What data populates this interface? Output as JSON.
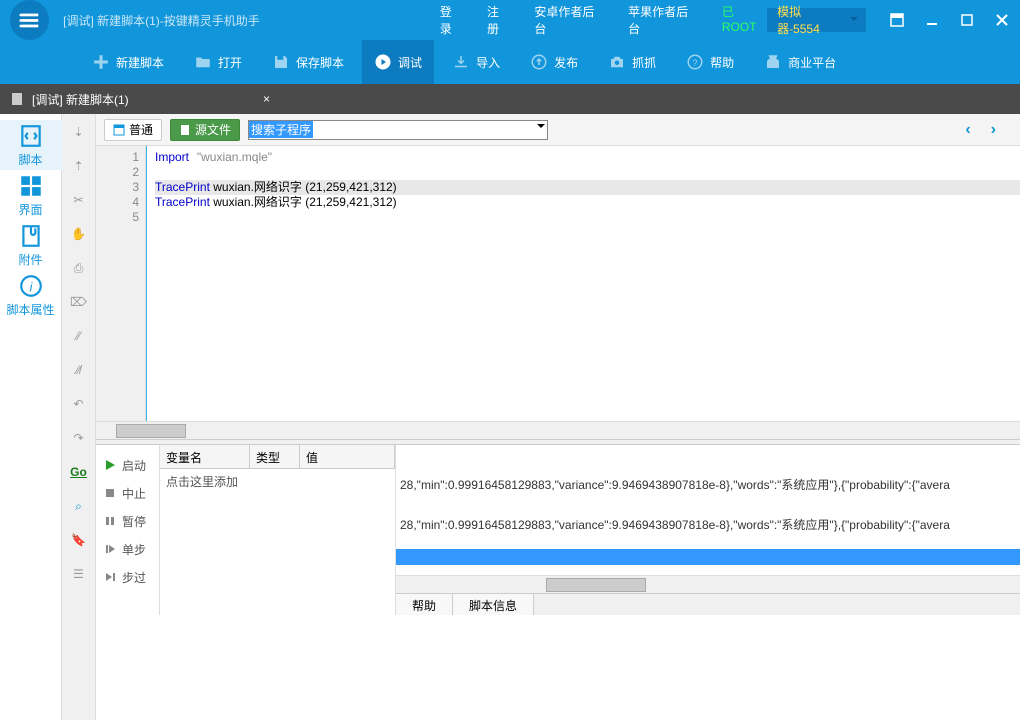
{
  "titlebar": {
    "title": "[调试] 新建脚本(1)-按键精灵手机助手",
    "links": {
      "login": "登录",
      "register": "注册",
      "android": "安卓作者后台",
      "ios": "苹果作者后台",
      "root": "已ROOT"
    },
    "device": "模拟器-5554"
  },
  "toolbar": {
    "new": "新建脚本",
    "open": "打开",
    "save": "保存脚本",
    "debug": "调试",
    "import": "导入",
    "publish": "发布",
    "capture": "抓抓",
    "help": "帮助",
    "market": "商业平台"
  },
  "tab": {
    "label": "[调试] 新建脚本(1)"
  },
  "leftnav": {
    "script": "脚本",
    "ui": "界面",
    "attach": "附件",
    "props": "脚本属性"
  },
  "editbar": {
    "normal": "普通",
    "source": "源文件",
    "search_placeholder": "搜索子程序"
  },
  "code": {
    "lines": [
      "1",
      "2",
      "3",
      "4",
      "5"
    ],
    "l1_kw": "Import",
    "l1_str": "\"wuxian.mqle\"",
    "l3_kw": "TracePrint",
    "l3_rest": " wuxian.网络识字 (21,259,421,312)",
    "l4_kw": "TracePrint",
    "l4_rest": " wuxian.网络识字 (21,259,421,312)"
  },
  "debug": {
    "start": "启动",
    "stop": "中止",
    "pause": "暂停",
    "step": "单步",
    "stepover": "步过"
  },
  "vartable": {
    "c1": "变量名",
    "c2": "类型",
    "c3": "值",
    "hint": "点击这里添加"
  },
  "output": {
    "line1": "28,\"min\":0.99916458129883,\"variance\":9.9469438907818e-8},\"words\":\"系统应用\"},{\"probability\":{\"avera",
    "line2": "28,\"min\":0.99916458129883,\"variance\":9.9469438907818e-8},\"words\":\"系统应用\"},{\"probability\":{\"avera",
    "tab1": "帮助",
    "tab2": "脚本信息"
  }
}
